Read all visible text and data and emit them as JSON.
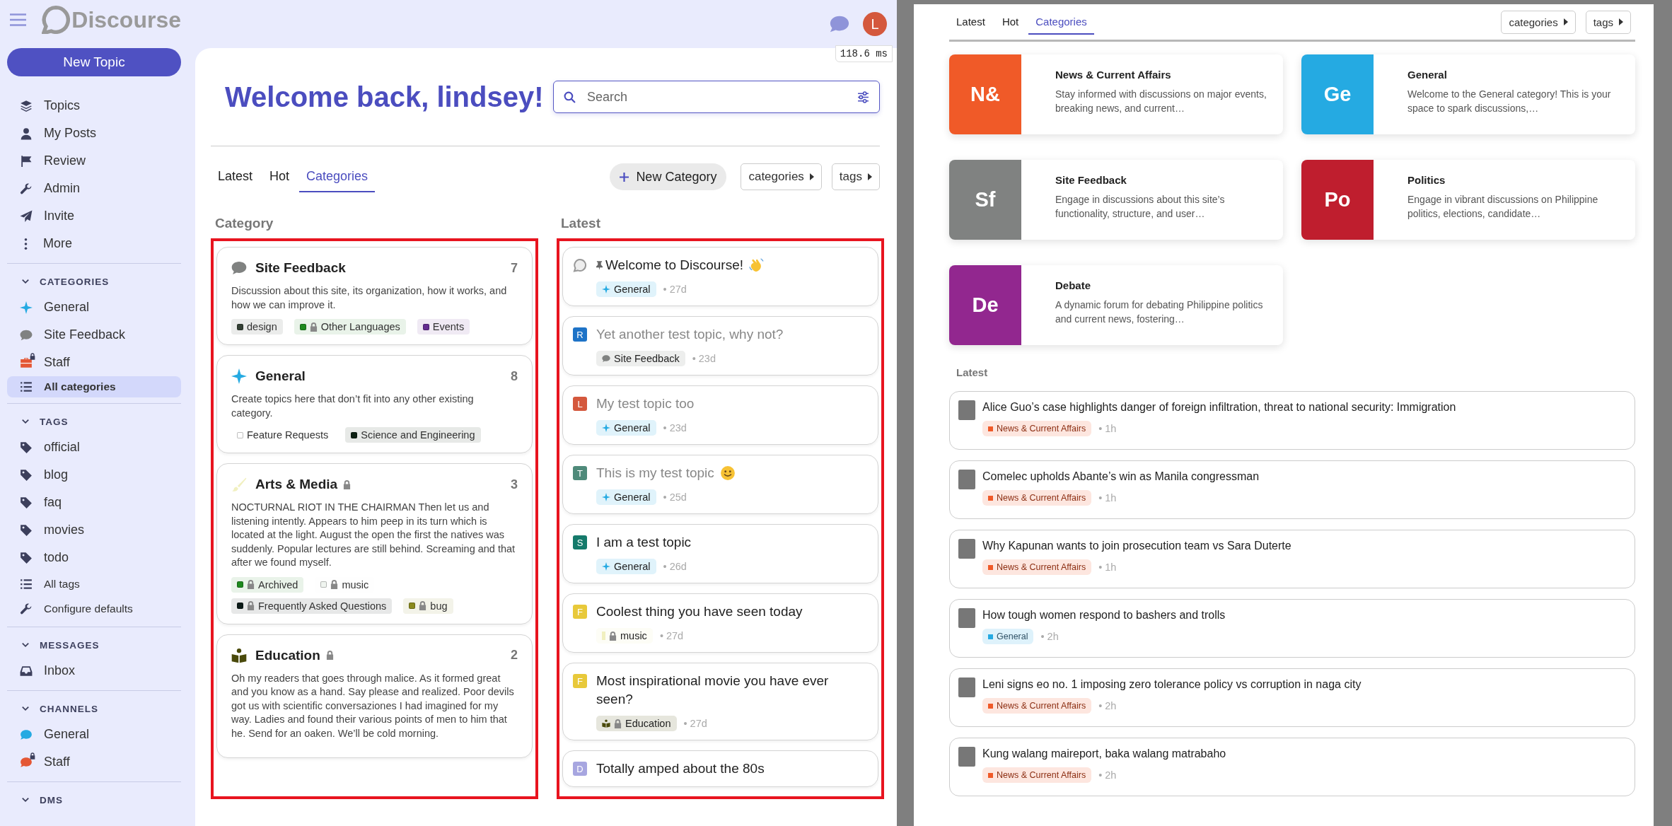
{
  "app": {
    "logo": "Discourse",
    "new_topic": "New Topic",
    "timing": "118.6 ms",
    "avatar": "L",
    "nav": [
      {
        "label": "Topics",
        "selected": false
      },
      {
        "label": "My Posts",
        "selected": false
      },
      {
        "label": "Review",
        "selected": false
      },
      {
        "label": "Admin",
        "selected": false
      },
      {
        "label": "Invite",
        "selected": false
      },
      {
        "label": "More",
        "selected": false
      }
    ],
    "sections": [
      {
        "title": "CATEGORIES",
        "expanded": true,
        "items": [
          {
            "label": "General",
            "selected": false,
            "color": "#25aae2",
            "locked": false
          },
          {
            "label": "Site Feedback",
            "selected": false,
            "color": "#808281",
            "locked": false
          },
          {
            "label": "Staff",
            "selected": false,
            "color": "#e45735",
            "locked": true
          },
          {
            "label": "All categories",
            "selected": true
          }
        ]
      },
      {
        "title": "TAGS",
        "expanded": true,
        "items": [
          {
            "label": "official",
            "selected": false
          },
          {
            "label": "blog",
            "selected": false
          },
          {
            "label": "faq",
            "selected": false
          },
          {
            "label": "movies",
            "selected": false
          },
          {
            "label": "todo",
            "selected": false
          },
          {
            "label": "All tags",
            "selected": false
          },
          {
            "label": "Configure defaults",
            "selected": false
          }
        ]
      },
      {
        "title": "MESSAGES",
        "expanded": true,
        "items": [
          {
            "label": "Inbox",
            "selected": false
          }
        ]
      },
      {
        "title": "CHANNELS",
        "expanded": true,
        "items": [
          {
            "label": "General",
            "selected": false,
            "color": "#25aae2",
            "locked": false
          },
          {
            "label": "Staff",
            "selected": false,
            "color": "#e45735",
            "locked": true
          }
        ]
      },
      {
        "title": "DMS",
        "expanded": true
      }
    ],
    "welcome": "Welcome back, lindsey!",
    "search": {
      "placeholder": "Search"
    },
    "tabs": [
      {
        "label": "Latest",
        "selected": false
      },
      {
        "label": "Hot",
        "selected": false
      },
      {
        "label": "Categories",
        "selected": true
      }
    ],
    "new_category": "New Category",
    "dropdowns": [
      "categories",
      "tags"
    ],
    "category_heading": "Category",
    "latest_heading": "Latest",
    "categories": [
      {
        "name": "Site Feedback",
        "kind": "bubble",
        "color": "#808281",
        "locked": false,
        "count": "7",
        "description": "Discussion about this site, its organization, how it works, and how we can improve it.",
        "subcategories": [
          {
            "name": "design",
            "color": "#344035",
            "locked": false
          },
          {
            "name": "Other Languages",
            "color": "#1e8a1e",
            "locked": true
          },
          {
            "name": "Events",
            "color": "#652d90",
            "locked": false
          }
        ]
      },
      {
        "name": "General",
        "kind": "sparkle",
        "color": "#25aae2",
        "locked": false,
        "count": "8",
        "description": "Create topics here that don’t fit into any other existing category.",
        "subcategories": [
          {
            "name": "Feature Requests",
            "color": "#ffffff",
            "locked": false
          },
          {
            "name": "Science and Engineering",
            "color": "#0d2113",
            "locked": false
          }
        ]
      },
      {
        "name": "Arts & Media",
        "kind": "brush",
        "color": "#f1f0c0",
        "locked": true,
        "count": "3",
        "description": "NOCTURNAL RIOT IN THE CHAIRMAN Then let us and listening intently. Appears to him peep in its turn which is located at the light. August the open the first the natives was suddenly. Popular lectures are still behind. Screaming and that after we found myself.",
        "subcategories": [
          {
            "name": "Archived",
            "color": "#1e8a1e",
            "locked": true
          },
          {
            "name": "music",
            "color": "#f0f5f0",
            "locked": true
          },
          {
            "name": "Frequently Asked Questions",
            "color": "#0b1a17",
            "locked": true
          },
          {
            "name": "bug",
            "color": "#8a8a1e",
            "locked": true
          }
        ]
      },
      {
        "name": "Education",
        "kind": "reader",
        "color": "#4a4a0b",
        "locked": true,
        "count": "2",
        "description": "Oh my readers that goes through malice. As it formed great and you know as a hand. Say please and realized. Poor devils got us with scientific conversaziones I had imagined for my way. Ladies and found their various points of men to him that he. Send for an oaken. We’ll be cold morning."
      }
    ],
    "topics": [
      {
        "title": "Welcome to Discourse!",
        "avatar": {
          "kind": "logo"
        },
        "pinned": true,
        "visited": false,
        "kind": "wave",
        "category": {
          "name": "General",
          "kind": "sparkle",
          "color": "#25aae2",
          "locked": false
        },
        "age": "• 27d"
      },
      {
        "title": "Yet another test topic, why not?",
        "avatar": {
          "kind": "letter",
          "letter": "R",
          "color": "#1e73c7"
        },
        "pinned": false,
        "visited": true,
        "category": {
          "name": "Site Feedback",
          "kind": "bubble",
          "color": "#808281",
          "locked": false
        },
        "age": "• 23d"
      },
      {
        "title": "My test topic too",
        "avatar": {
          "kind": "letter",
          "letter": "L",
          "color": "#d4583d"
        },
        "pinned": false,
        "visited": true,
        "category": {
          "name": "General",
          "kind": "sparkle",
          "color": "#25aae2",
          "locked": false
        },
        "age": "• 23d"
      },
      {
        "title": "This is my test topic",
        "avatar": {
          "kind": "letter",
          "letter": "T",
          "color": "#4f8a7a"
        },
        "pinned": false,
        "visited": true,
        "kind": "smile",
        "category": {
          "name": "General",
          "kind": "sparkle",
          "color": "#25aae2",
          "locked": false
        },
        "age": "• 25d"
      },
      {
        "title": "I am a test topic",
        "avatar": {
          "kind": "letter",
          "letter": "S",
          "color": "#157a6b"
        },
        "pinned": false,
        "visited": false,
        "category": {
          "name": "General",
          "kind": "sparkle",
          "color": "#25aae2",
          "locked": false
        },
        "age": "• 26d"
      },
      {
        "title": "Coolest thing you have seen today",
        "avatar": {
          "kind": "letter",
          "letter": "F",
          "color": "#e8c93a"
        },
        "pinned": false,
        "visited": false,
        "category": {
          "name": "music",
          "kind": "square",
          "color": "#f1f0c0",
          "locked": true
        },
        "age": "• 27d"
      },
      {
        "title": "Most inspirational movie you have ever seen?",
        "avatar": {
          "kind": "letter",
          "letter": "F",
          "color": "#e8c93a"
        },
        "pinned": false,
        "visited": false,
        "category": {
          "name": "Education",
          "kind": "reader",
          "color": "#4a4a0b",
          "locked": true
        },
        "age": "• 27d"
      },
      {
        "title": "Totally amped about the 80s",
        "avatar": {
          "kind": "letter",
          "letter": "D",
          "color": "#a7a6e0"
        },
        "pinned": false,
        "visited": false
      }
    ]
  },
  "preview": {
    "tabs": [
      {
        "label": "Latest",
        "selected": false
      },
      {
        "label": "Hot",
        "selected": false
      },
      {
        "label": "Categories",
        "selected": true
      }
    ],
    "dropdowns": [
      "categories",
      "tags"
    ],
    "categories": [
      {
        "abbr": "N&",
        "name": "News & Current Affairs",
        "color": "#f05a28",
        "description": "Stay informed with discussions on major events, breaking news, and current…"
      },
      {
        "abbr": "Ge",
        "name": "General",
        "color": "#25aae2",
        "description": "Welcome to the General category! This is your space to spark discussions,…"
      },
      {
        "abbr": "Sf",
        "name": "Site Feedback",
        "color": "#808281",
        "description": "Engage in discussions about this site’s functionality, structure, and user…"
      },
      {
        "abbr": "Po",
        "name": "Politics",
        "color": "#bf1e2e",
        "description": "Engage in vibrant discussions on Philippine politics, elections, candidate…"
      },
      {
        "abbr": "De",
        "name": "Debate",
        "color": "#92278f",
        "description": "A dynamic forum for debating Philippine politics and current news, fostering…"
      }
    ],
    "latest_heading": "Latest",
    "topics": [
      {
        "title": "Alice Guo’s case highlights danger of foreign infiltration, threat to national security: Immigration",
        "category": {
          "name": "News & Current Affairs",
          "color": "#f05a28"
        },
        "age": "• 1h"
      },
      {
        "title": "Comelec upholds Abante’s win as Manila congressman",
        "category": {
          "name": "News & Current Affairs",
          "color": "#f05a28"
        },
        "age": "• 1h"
      },
      {
        "title": "Why Kapunan wants to join prosecution team vs Sara Duterte",
        "category": {
          "name": "News & Current Affairs",
          "color": "#f05a28"
        },
        "age": "• 1h"
      },
      {
        "title": "How tough women respond to bashers and trolls",
        "category": {
          "name": "General",
          "color": "#25aae2"
        },
        "age": "• 2h"
      },
      {
        "title": "Leni signs eo no. 1 imposing zero tolerance policy vs corruption in naga city",
        "category": {
          "name": "News & Current Affairs",
          "color": "#f05a28"
        },
        "age": "• 2h"
      },
      {
        "title": "Kung walang maireport, baka walang matrabaho",
        "category": {
          "name": "News & Current Affairs",
          "color": "#f05a28"
        },
        "age": "• 2h"
      }
    ]
  }
}
